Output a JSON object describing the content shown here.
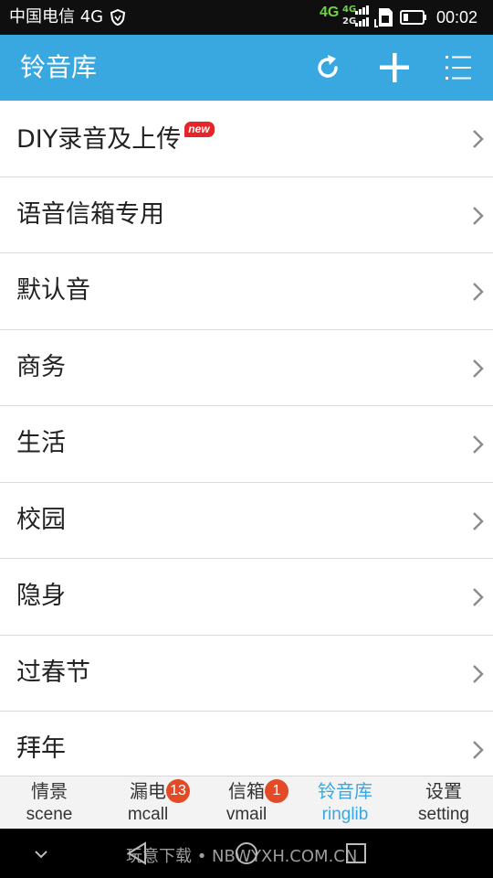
{
  "status_bar": {
    "carrier": "中国电信 4G",
    "network_4g": "4G",
    "sim_primary": "4G",
    "sim_secondary": "2G",
    "time": "00:02"
  },
  "app_bar": {
    "title": "铃音库",
    "actions": [
      "refresh-icon",
      "add-icon",
      "list-menu-icon"
    ]
  },
  "list": {
    "items": [
      {
        "label": "DIY录音及上传",
        "badge": "new"
      },
      {
        "label": "语音信箱专用"
      },
      {
        "label": "默认音"
      },
      {
        "label": "商务"
      },
      {
        "label": "生活"
      },
      {
        "label": "校园"
      },
      {
        "label": "隐身"
      },
      {
        "label": "过春节"
      },
      {
        "label": "拜年"
      }
    ]
  },
  "tabs": [
    {
      "cn": "情景",
      "en": "scene"
    },
    {
      "cn": "漏电",
      "en": "mcall",
      "badge": "13"
    },
    {
      "cn": "信箱",
      "en": "vmail",
      "badge": "1"
    },
    {
      "cn": "铃音库",
      "en": "ringlib",
      "active": true
    },
    {
      "cn": "设置",
      "en": "setting"
    }
  ],
  "nav_bar": {
    "watermark": "玩意下载 • NBWYXH.COM.CN"
  },
  "colors": {
    "accent": "#39a8e0",
    "badge": "#e24b26",
    "new_badge": "#e5252a",
    "status_bar": "#0f0f0f"
  }
}
